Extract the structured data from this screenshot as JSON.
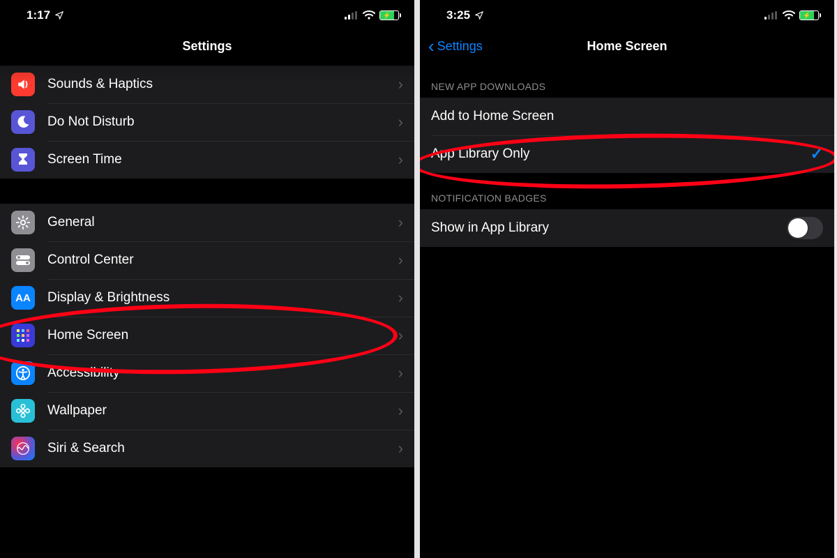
{
  "left": {
    "status": {
      "time": "1:17"
    },
    "title": "Settings",
    "group1": [
      {
        "label": "Sounds & Haptics",
        "icon": "sounds"
      },
      {
        "label": "Do Not Disturb",
        "icon": "dnd"
      },
      {
        "label": "Screen Time",
        "icon": "screentime"
      }
    ],
    "group2": [
      {
        "label": "General",
        "icon": "general"
      },
      {
        "label": "Control Center",
        "icon": "control"
      },
      {
        "label": "Display & Brightness",
        "icon": "display"
      },
      {
        "label": "Home Screen",
        "icon": "home"
      },
      {
        "label": "Accessibility",
        "icon": "access"
      },
      {
        "label": "Wallpaper",
        "icon": "wallpaper"
      },
      {
        "label": "Siri & Search",
        "icon": "siri"
      }
    ]
  },
  "right": {
    "status": {
      "time": "3:25"
    },
    "back_label": "Settings",
    "title": "Home Screen",
    "section1_header": "NEW APP DOWNLOADS",
    "section1": [
      {
        "label": "Add to Home Screen",
        "checked": false
      },
      {
        "label": "App Library Only",
        "checked": true
      }
    ],
    "section2_header": "NOTIFICATION BADGES",
    "section2_item": {
      "label": "Show in App Library",
      "on": false
    }
  }
}
